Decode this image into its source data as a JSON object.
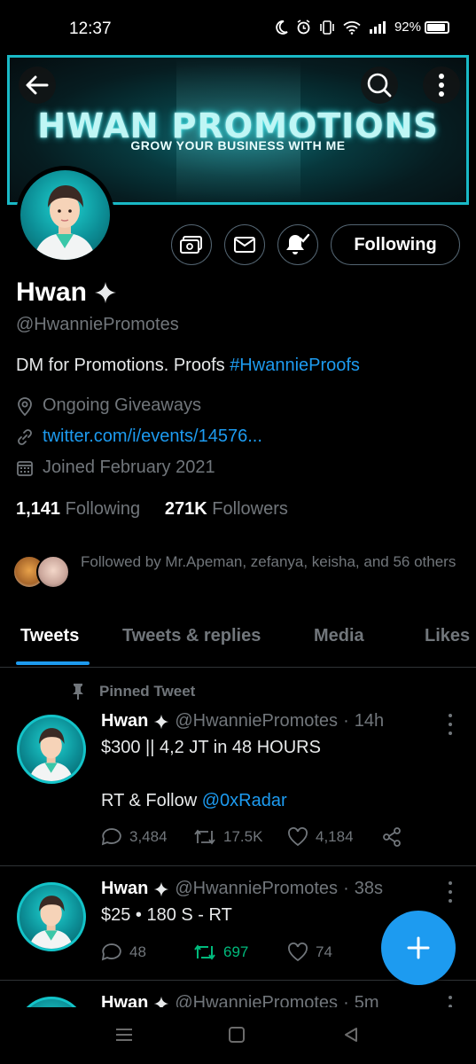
{
  "status_bar": {
    "time": "12:37",
    "battery": "92%",
    "battery_level": 0.92
  },
  "banner": {
    "title": "HWAN PROMOTIONS",
    "subtitle": "GROW YOUR BUSINESS WITH ME"
  },
  "header_icons": [
    "arrow-left-icon",
    "search-icon",
    "more-vertical-icon"
  ],
  "profile": {
    "name": "Hwan",
    "handle": "@HwanniePromotes",
    "bio_text": "DM for Promotions. Proofs ",
    "bio_hashtag": "#HwannieProofs",
    "location": "Ongoing Giveaways",
    "link": "twitter.com/i/events/14576...",
    "joined": "Joined February 2021",
    "following_count": "1,141",
    "following_label": "Following",
    "followers_count": "271K",
    "followers_label": "Followers",
    "followed_by": "Followed by Mr.Apeman, zefanya, keisha, and 56 others",
    "follow_button": "Following"
  },
  "tabs": [
    "Tweets",
    "Tweets & replies",
    "Media",
    "Likes"
  ],
  "active_tab": "Tweets",
  "colors": {
    "accent": "#1d9bf0",
    "retweet_active": "#00ba7c",
    "muted": "#71767b"
  },
  "tweets": [
    {
      "pinned_label": "Pinned Tweet",
      "name": "Hwan",
      "handle": "@HwanniePromotes",
      "time": "14h",
      "line1": "$300 || 4,2 JT in 48 HOURS",
      "line2_prefix": "RT & Follow ",
      "line2_mention": "@0xRadar",
      "replies": "3,484",
      "retweets": "17.5K",
      "likes": "4,184"
    },
    {
      "name": "Hwan",
      "handle": "@HwanniePromotes",
      "time": "38s",
      "line1": "$25 • 180 S - RT",
      "replies": "48",
      "retweets": "697",
      "likes": "74"
    },
    {
      "name": "Hwan",
      "handle": "@HwanniePromotes",
      "time": "5m"
    }
  ]
}
